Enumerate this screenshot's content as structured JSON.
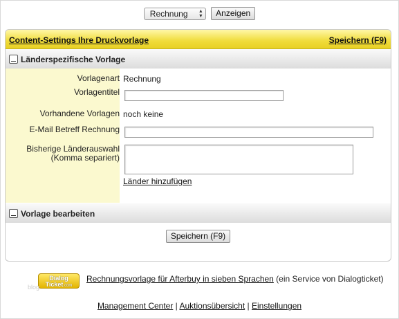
{
  "topbar": {
    "select_value": "Rechnung",
    "show_button": "Anzeigen"
  },
  "panel": {
    "title": "Content-Settings Ihre Druckvorlage",
    "save": "Speichern (F9)"
  },
  "section1": {
    "title": "Länderspezifische Vorlage",
    "fields": {
      "vorlagenart_label": "Vorlagenart",
      "vorlagenart_value": "Rechnung",
      "vorlagentitel_label": "Vorlagentitel",
      "vorlagentitel_value": "",
      "vorhandene_label": "Vorhandene Vorlagen",
      "vorhandene_value": "noch keine",
      "email_label": "E-Mail Betreff Rechnung",
      "email_value": "",
      "laender_label_1": "Bisherige Länderauswahl",
      "laender_label_2": "(Komma separiert)",
      "laender_value": "",
      "add_countries_link": "Länder hinzufügen"
    }
  },
  "section2": {
    "title": "Vorlage bearbeiten",
    "save_button": "Speichern (F9)"
  },
  "footer": {
    "logo_line1": "Dialog",
    "logo_line2": "Ticket",
    "logo_suffix": ".com",
    "blog": "blog",
    "service_link": "Rechnungsvorlage für Afterbuy in sieben Sprachen",
    "service_text": " (ein Service von Dialogticket)",
    "nav": [
      "Management Center",
      "Auktionsübersicht",
      "Einstellungen"
    ],
    "separator": " | "
  },
  "colors": {
    "header_yellow": "#f0dc3a",
    "label_column": "#fbf9cf"
  }
}
